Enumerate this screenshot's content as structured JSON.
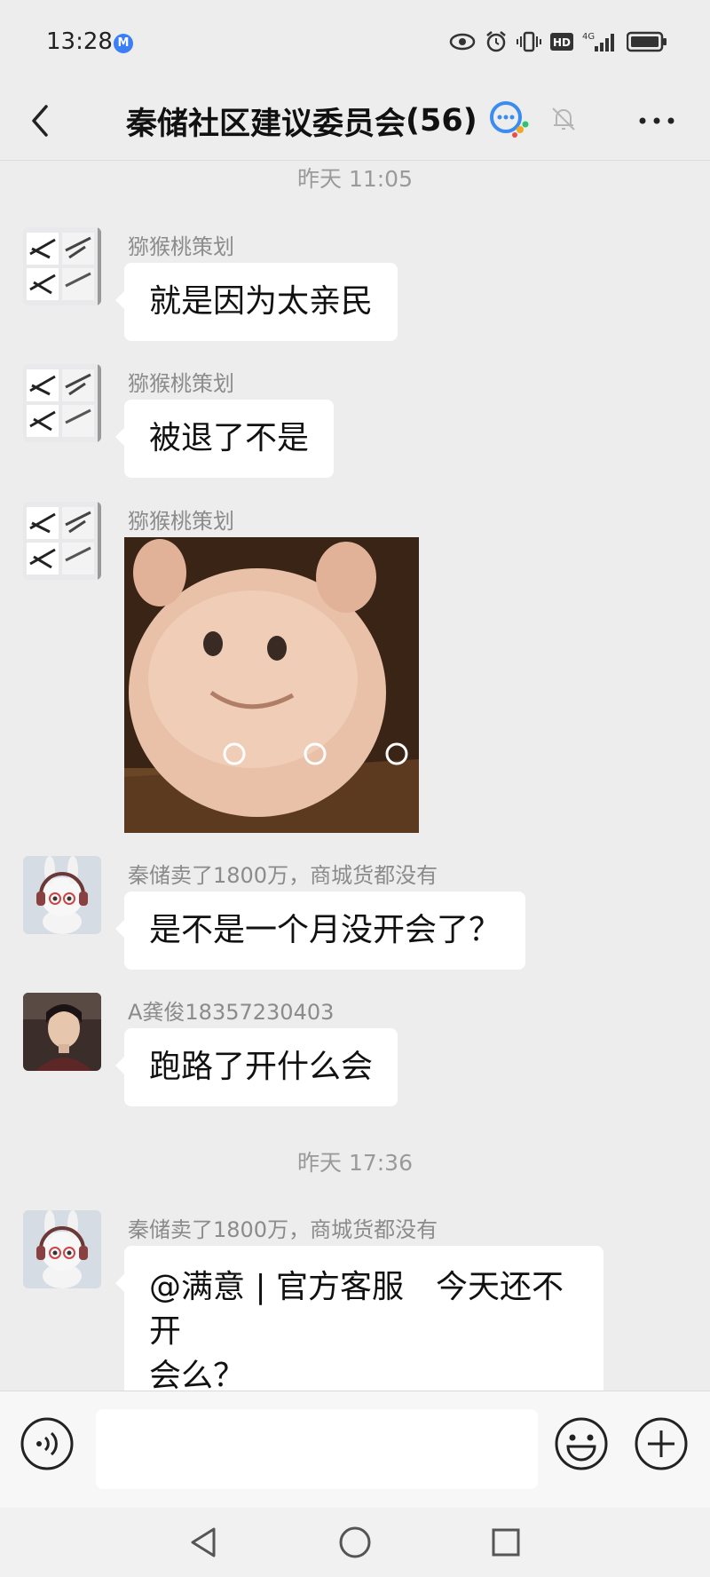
{
  "status_bar": {
    "time": "13:28",
    "app_badge": "M",
    "network": "4G",
    "icons": [
      "eye-icon",
      "alarm-icon",
      "vibrate-icon",
      "hd-icon",
      "signal-icon",
      "battery-icon"
    ]
  },
  "header": {
    "title": "秦储社区建议委员会",
    "member_count": "(56)"
  },
  "messages": [
    {
      "type": "time",
      "text": "昨天 11:05"
    },
    {
      "type": "text",
      "sender": "猕猴桃策划",
      "text": "就是因为太亲民"
    },
    {
      "type": "text",
      "sender": "猕猴桃策划",
      "text": "被退了不是"
    },
    {
      "type": "sticker",
      "sender": "猕猴桃策划",
      "description": "pig-sticker"
    },
    {
      "type": "text",
      "sender": "秦储卖了1800万，商城货都没有",
      "text": "是不是一个月没开会了？"
    },
    {
      "type": "text",
      "sender": "A龚俊18357230403",
      "text": "跑路了开什么会"
    },
    {
      "type": "time",
      "text": "昨天 17:36"
    },
    {
      "type": "text",
      "sender": "秦储卖了1800万，商城货都没有",
      "text_line1": "@满意 | 官方客服　今天还不开",
      "text_line2": "会么？"
    }
  ],
  "input": {
    "value": "",
    "placeholder": ""
  },
  "colors": {
    "background": "#EDEDED",
    "bubble": "#FFFFFF",
    "nickname": "#8B8B8B",
    "timestamp": "#9A9A9A"
  }
}
